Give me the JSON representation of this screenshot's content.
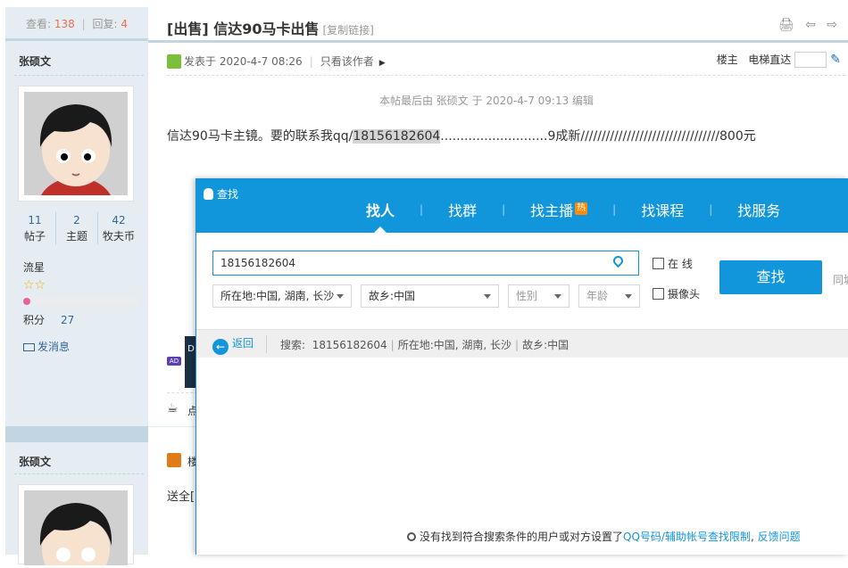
{
  "thread": {
    "views_label": "查看:",
    "views": "138",
    "replies_label": "回复:",
    "replies": "4",
    "title": "[出售] 信达90马卡出售",
    "copy_link": "[复制链接]",
    "title_tools": "🖨 ⇦ ⇨"
  },
  "author": {
    "name": "张硕文",
    "counts": [
      {
        "value": "11",
        "label": "帖子"
      },
      {
        "value": "2",
        "label": "主题"
      },
      {
        "value": "42",
        "label": "牧夫币"
      }
    ],
    "rank": "流星",
    "stars": "☆☆",
    "rank_progress": 0.06,
    "score_label": "积分",
    "score": "27",
    "send_message": "发消息"
  },
  "post": {
    "posted_at": "发表于 2020-4-7 08:26",
    "only_author": "只看该作者",
    "floor_label": "楼主",
    "elevator_label": "电梯直达",
    "edit_note": "本帖最后由 张硕文 于 2020-4-7 09:13 编辑",
    "body_prefix": "信达90马卡主镜。要的联系我qq/",
    "body_highlight": "18156182604",
    "body_suffix": "...........................9成新/////////////////////////////////800元",
    "ad_tag": "AD",
    "ad_box": "D",
    "rate_text": "点"
  },
  "post2": {
    "author_name": "张硕文",
    "floor_label": "楼",
    "body": "送全[]"
  },
  "qq_find": {
    "window_title": "查找",
    "tabs": [
      {
        "label": "找人",
        "active": true
      },
      {
        "label": "找群"
      },
      {
        "label": "找主播",
        "badge": "热"
      },
      {
        "label": "找课程"
      },
      {
        "label": "找服务"
      }
    ],
    "tab_separator": "|",
    "search_value": "18156182604",
    "location_select": "所在地:中国, 湖南, 长沙",
    "hometown_select": "故乡:中国",
    "gender_placeholder": "性别",
    "age_placeholder": "年龄",
    "online_label": "在  线",
    "camera_label": "摄像头",
    "find_button": "查找",
    "side_text": "同城",
    "back_label": "返回",
    "crumb_prefix": "搜索:",
    "crumb_query": "18156182604",
    "crumb_location": "所在地:中国, 湖南, 长沙",
    "crumb_hometown": "故乡:中国",
    "crumb_separator": "|",
    "no_result_text": "没有找到符合搜索条件的用户或对方设置了",
    "no_result_link1": "QQ号码/辅助帐号查找限制",
    "no_result_comma": ",",
    "no_result_link2": "反馈问题"
  },
  "colors": {
    "qq_blue": "#1296db",
    "forum_panel": "#e5edf2",
    "forum_border": "#c2d5e3",
    "count_red": "#f26c4f",
    "link_blue": "#336699"
  }
}
